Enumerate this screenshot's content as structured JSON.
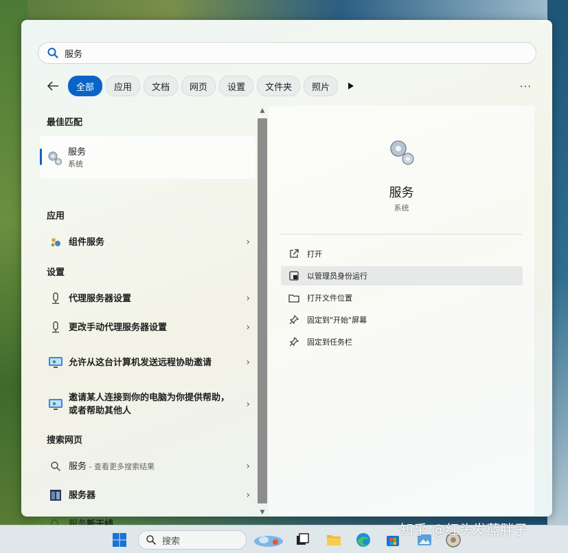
{
  "search": {
    "value": "服务"
  },
  "tabs": {
    "items": [
      "全部",
      "应用",
      "文档",
      "网页",
      "设置",
      "文件夹",
      "照片"
    ],
    "more": "···"
  },
  "best_match": {
    "title": "最佳匹配",
    "name": "服务",
    "subtitle": "系统"
  },
  "apps": {
    "title": "应用",
    "items": [
      {
        "label": "组件服务"
      }
    ]
  },
  "settings": {
    "title": "设置",
    "items": [
      {
        "label": "代理服务器设置"
      },
      {
        "label": "更改手动代理服务器设置"
      },
      {
        "label": "允许从这台计算机发送远程协助邀请"
      },
      {
        "label": "邀请某人连接到你的电脑为你提供帮助，或者帮助其他人"
      }
    ]
  },
  "web": {
    "title": "搜索网页",
    "items": [
      {
        "label": "服务",
        "suffix": " - 查看更多搜索结果"
      },
      {
        "label": "服务器"
      },
      {
        "label": "服务",
        "bold_suffix": "新干线"
      }
    ]
  },
  "details": {
    "title": "服务",
    "subtitle": "系统",
    "actions": [
      {
        "label": "打开"
      },
      {
        "label": "以管理员身份运行"
      },
      {
        "label": "打开文件位置"
      },
      {
        "label": "固定到\"开始\"屏幕"
      },
      {
        "label": "固定到任务栏"
      }
    ]
  },
  "taskbar": {
    "search_label": "搜索"
  },
  "watermark": "知乎 @红头发蓝胖子",
  "colors": {
    "accent": "#0a64c8"
  }
}
